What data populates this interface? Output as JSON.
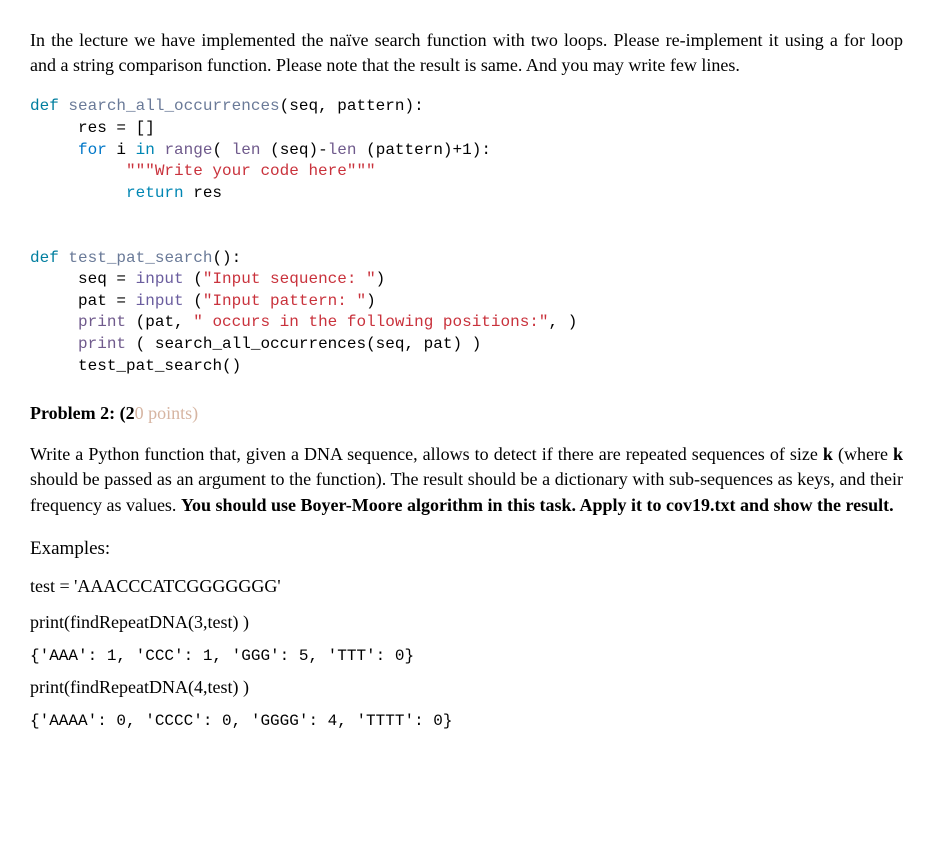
{
  "problem1": {
    "intro": "In the lecture we have implemented the naïve search function with two loops. Please re-implement it using a for loop and a string comparison function. Please note that the result is same. And you may write few lines."
  },
  "code1": {
    "l1": {
      "def": "def",
      "fn": "search_all_occurrences",
      "args": "(seq, pattern):"
    },
    "l2": "res = []",
    "l3": {
      "kfor": "for",
      "var": " i ",
      "kin": "in",
      "sp": " ",
      "krange": "range",
      "open": "( ",
      "klen1": "len",
      "a1": " (seq)-",
      "klen2": "len",
      "a2": " (pattern)+1):"
    },
    "l4": "\"\"\"Write your code here\"\"\"",
    "l5": {
      "kreturn": "return",
      "rest": " res"
    }
  },
  "code2": {
    "l1": {
      "def": "def",
      "fn": "test_pat_search",
      "args": "():"
    },
    "l2": {
      "pre": "seq = ",
      "kinput": "input",
      "mid": " (",
      "str": "\"Input sequence: \"",
      "end": ")"
    },
    "l3": {
      "pre": "pat = ",
      "kinput": "input",
      "mid": " (",
      "str": "\"Input pattern: \"",
      "end": ")"
    },
    "l4": {
      "kprint": "print",
      "mid": " (pat, ",
      "str": "\" occurs in the following positions:\"",
      "end": ", )"
    },
    "l5": {
      "kprint": "print",
      "rest": " ( search_all_occurrences(seq, pat) )"
    },
    "l6": "test_pat_search()"
  },
  "problem2": {
    "heading_prefix": "Problem 2: (2",
    "heading_points": "0 points)",
    "text_part1": "Write a Python function that, given a DNA sequence, allows to detect if there are repeated sequences of size ",
    "k1": "k",
    "text_part2": " (where ",
    "k2": "k",
    "text_part3": " should be passed as an argument to the function). The result should be a dictionary with sub-sequences as keys, and their frequency as values. ",
    "bold_tail": "You should use Boyer-Moore algorithm in this task. Apply it to cov19.txt and show the result."
  },
  "examples": {
    "label": "Examples:",
    "test_line": "test = 'AAACCCATCGGGGGGG'",
    "call1": "print(findRepeatDNA(3,test) )",
    "out1": "{'AAA': 1, 'CCC': 1, 'GGG': 5, 'TTT': 0}",
    "call2": "print(findRepeatDNA(4,test) )",
    "out2": "{'AAAA': 0, 'CCCC': 0, 'GGGG': 4, 'TTTT': 0}"
  }
}
